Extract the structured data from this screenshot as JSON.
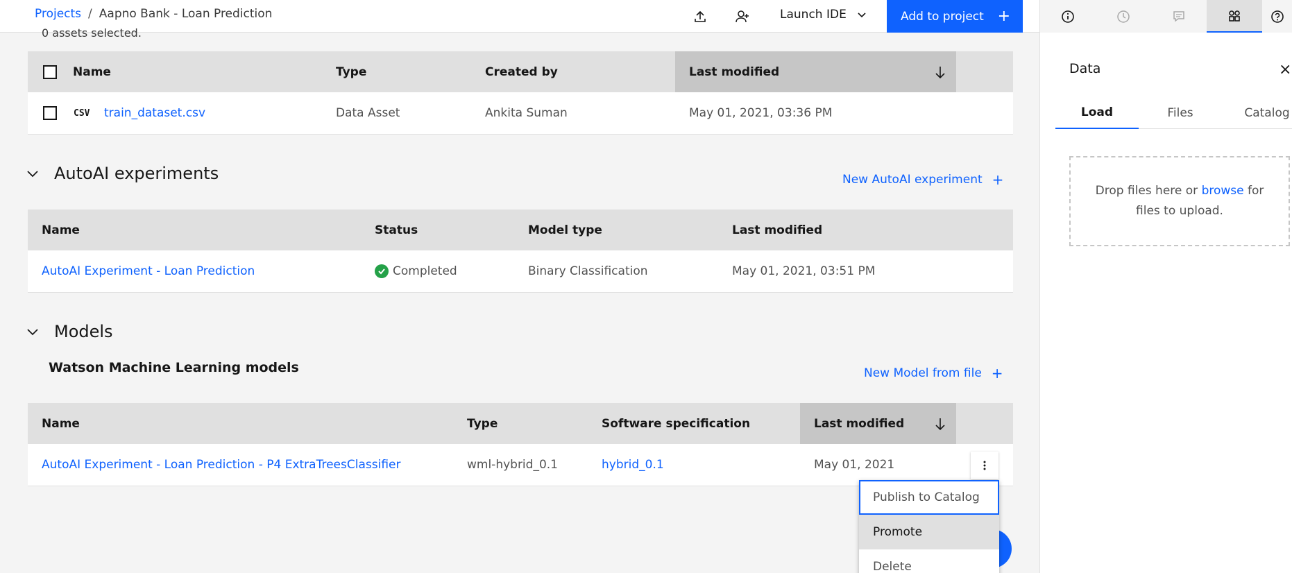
{
  "header": {
    "breadcrumb": {
      "projects": "Projects",
      "separator": "/",
      "current": "Aapno Bank - Loan Prediction"
    },
    "launch_ide": "Launch IDE",
    "add_to_project": "Add to project",
    "icons": [
      "upload-icon",
      "add-collaborator-icon",
      "chevron-down-icon"
    ]
  },
  "rail": {
    "tabs": [
      "info-icon",
      "history-icon",
      "comment-icon",
      "data-assets-icon",
      "help-icon"
    ],
    "active_tab": "data-assets-icon",
    "title": "Data",
    "close": "×",
    "panel_tabs": [
      "Load",
      "Files",
      "Catalog"
    ],
    "active_panel_tab": "Load",
    "dropzone": {
      "before": "Drop files here or ",
      "link": "browse",
      "after": " for files to upload."
    }
  },
  "assets": {
    "selected_text": "0 assets selected.",
    "columns": [
      "Name",
      "Type",
      "Created by",
      "Last modified"
    ],
    "sorted_column": "Last modified",
    "rows": [
      {
        "file_type": "CSV",
        "name": "train_dataset.csv",
        "type": "Data Asset",
        "created_by": "Ankita Suman",
        "last_modified": "May 01, 2021, 03:36 PM"
      }
    ]
  },
  "autoai": {
    "title": "AutoAI experiments",
    "new_link": "New AutoAI experiment",
    "columns": [
      "Name",
      "Status",
      "Model type",
      "Last modified"
    ],
    "rows": [
      {
        "name": "AutoAI Experiment - Loan Prediction",
        "status": "Completed",
        "model_type": "Binary Classification",
        "last_modified": "May 01, 2021, 03:51 PM"
      }
    ]
  },
  "models": {
    "title": "Models",
    "subtitle": "Watson Machine Learning models",
    "new_link": "New Model from file",
    "columns": [
      "Name",
      "Type",
      "Software specification",
      "Last modified"
    ],
    "sorted_column": "Last modified",
    "rows": [
      {
        "name": "AutoAI Experiment - Loan Prediction - P4 ExtraTreesClassifier",
        "type": "wml-hybrid_0.1",
        "software_spec": "hybrid_0.1",
        "last_modified": "May 01, 2021"
      }
    ]
  },
  "overflow_menu": {
    "items": [
      "Publish to Catalog",
      "Promote",
      "Delete"
    ],
    "focused": "Publish to Catalog",
    "hovered": "Promote"
  },
  "colors": {
    "accent": "#0f62fe",
    "success": "#24a148",
    "header_bg": "#e0e0e0",
    "page_bg": "#f4f4f4"
  }
}
